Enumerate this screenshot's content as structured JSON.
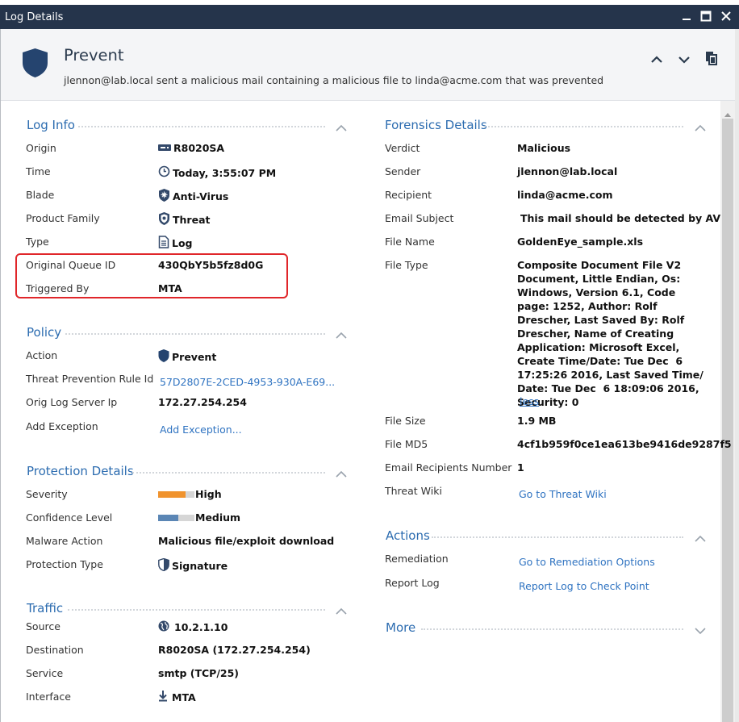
{
  "window": {
    "title": "Log Details"
  },
  "header": {
    "title": "Prevent",
    "subtitle": "jlennon@lab.local sent a malicious mail containing a malicious file to linda@acme.com that was prevented"
  },
  "log_info": {
    "title": "Log Info",
    "origin": {
      "label": "Origin",
      "value": "R8020SA",
      "icon": "gateway-icon"
    },
    "time": {
      "label": "Time",
      "value": "Today, 3:55:07 PM",
      "icon": "clock-icon"
    },
    "blade": {
      "label": "Blade",
      "value": "Anti-Virus",
      "icon": "antivirus-icon"
    },
    "product_family": {
      "label": "Product Family",
      "value": "Threat",
      "icon": "threat-shield-icon"
    },
    "type": {
      "label": "Type",
      "value": "Log",
      "icon": "log-document-icon"
    },
    "queue_id": {
      "label": "Original Queue ID",
      "value": "430QbY5b5fz8d0G"
    },
    "triggered_by": {
      "label": "Triggered By",
      "value": "MTA"
    }
  },
  "policy": {
    "title": "Policy",
    "action": {
      "label": "Action",
      "value": "Prevent",
      "icon": "shield-icon"
    },
    "rule_id": {
      "label": "Threat Prevention Rule Id",
      "value": "57D2807E-2CED-4953-930A-E69..."
    },
    "server_ip": {
      "label": "Orig Log Server Ip",
      "value": "172.27.254.254"
    },
    "add_exception": {
      "label": "Add Exception",
      "value": "Add Exception..."
    }
  },
  "protection": {
    "title": "Protection Details",
    "severity": {
      "label": "Severity",
      "value": "High",
      "level": 0.75,
      "color": "#f0932e"
    },
    "confidence": {
      "label": "Confidence Level",
      "value": "Medium",
      "level": 0.55,
      "color": "#5b86b5"
    },
    "malware_action": {
      "label": "Malware Action",
      "value": "Malicious file/exploit download"
    },
    "protection_type": {
      "label": "Protection Type",
      "value": "Signature",
      "icon": "signature-shield-icon"
    }
  },
  "traffic": {
    "title": "Traffic",
    "source": {
      "label": "Source",
      "value": "10.2.1.10",
      "icon": "globe-icon"
    },
    "destination": {
      "label": "Destination",
      "value": "R8020SA (172.27.254.254)"
    },
    "service": {
      "label": "Service",
      "value": "smtp (TCP/25)"
    },
    "interface": {
      "label": "Interface",
      "value": "MTA",
      "icon": "arrow-down-icon"
    }
  },
  "forensics": {
    "title": "Forensics Details",
    "verdict": {
      "label": "Verdict",
      "value": "Malicious"
    },
    "sender": {
      "label": "Sender",
      "value": "jlennon@lab.local"
    },
    "recipient": {
      "label": "Recipient",
      "value": "linda@acme.com"
    },
    "subject": {
      "label": "Email Subject",
      "value": "This mail should be detected by AV"
    },
    "file_name": {
      "label": "File Name",
      "value": "GoldenEye_sample.xls"
    },
    "file_type": {
      "label": "File Type",
      "value": "Composite Document File V2 Document, Little Endian, Os: Windows, Version 6.1, Code page: 1252, Author: Rolf Drescher, Last Saved By: Rolf Drescher, Name of Creating Application: Microsoft Excel, Create Time/Date: Tue Dec  6 17:25:26 2016, Last Saved Time/ Date: Tue Dec  6 18:09:06 2016, Security: 0",
      "less": "less"
    },
    "file_size": {
      "label": "File Size",
      "value": "1.9 MB"
    },
    "file_md5": {
      "label": "File MD5",
      "value": "4cf1b959f0ce1ea613be9416de9287f5"
    },
    "recipients_number": {
      "label": "Email Recipients Number",
      "value": "1"
    },
    "threat_wiki": {
      "label": "Threat Wiki",
      "value": "Go to Threat Wiki"
    }
  },
  "actions": {
    "title": "Actions",
    "remediation": {
      "label": "Remediation",
      "value": "Go to Remediation Options"
    },
    "report_log": {
      "label": "Report Log",
      "value": "Report Log to Check Point"
    }
  },
  "more": {
    "title": "More"
  },
  "colors": {
    "titlebar": "#25344b",
    "link": "#2f73c1",
    "section_title": "#2c6cb0",
    "highlight": "#e0262a"
  }
}
